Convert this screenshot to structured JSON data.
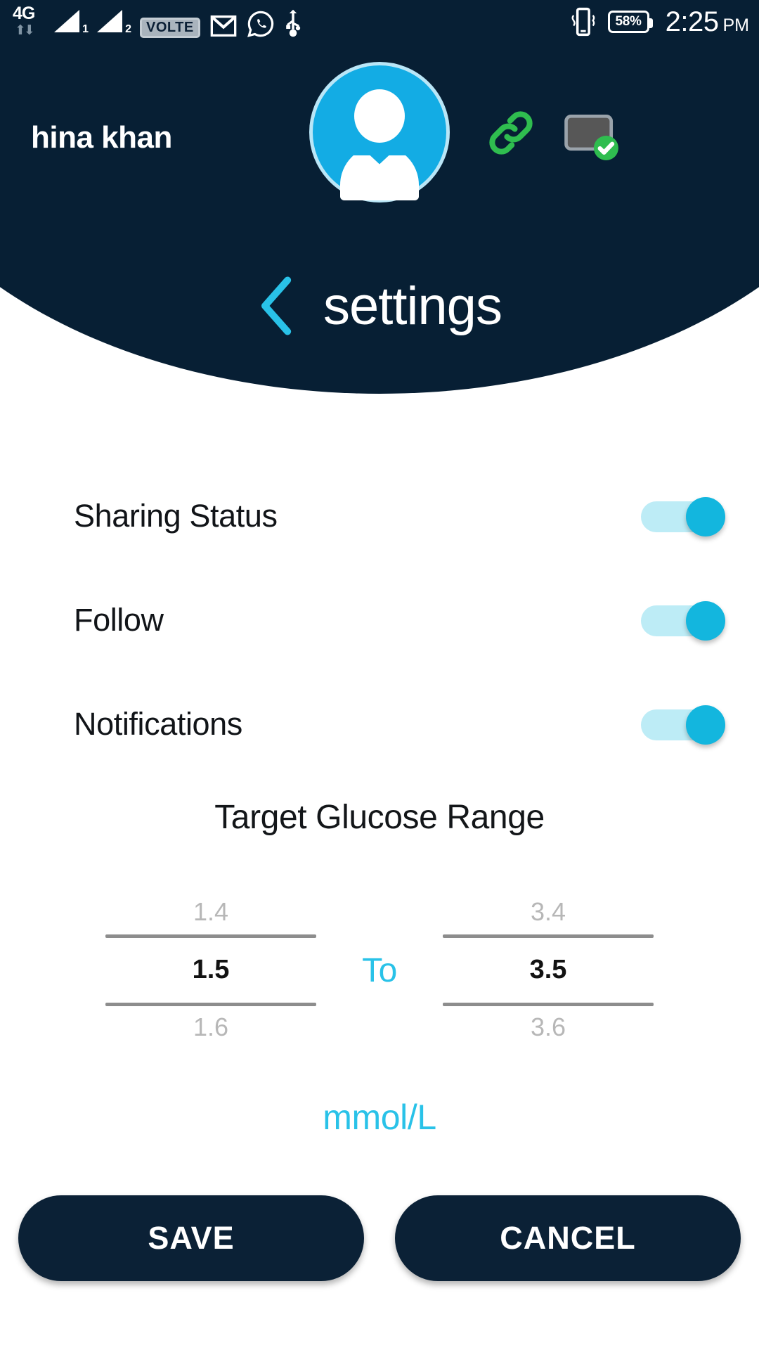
{
  "statusbar": {
    "network_label": "4G",
    "sim1_label": "1",
    "sim2_label": "2",
    "volte_label": "VOLTE",
    "battery_percent": "58%",
    "time": "2:25",
    "meridiem": "PM",
    "icons": [
      "4g-icon",
      "signal-sim1-icon",
      "signal-sim2-icon",
      "volte-badge",
      "gmail-icon",
      "whatsapp-icon",
      "usb-icon",
      "vibrate-icon",
      "battery-icon"
    ]
  },
  "header": {
    "user_name": "hina khan",
    "avatar_icon": "person-avatar-icon",
    "link_icon": "chain-link-icon",
    "cast_icon": "device-connected-icon",
    "background_color": "#071f34",
    "accent_color": "#29c2e8"
  },
  "page": {
    "title": "settings",
    "back_icon": "chevron-left-icon"
  },
  "settings": {
    "items": [
      {
        "label": "Sharing Status",
        "enabled": true
      },
      {
        "label": "Follow",
        "enabled": true
      },
      {
        "label": "Notifications",
        "enabled": true
      }
    ]
  },
  "glucose_range": {
    "title": "Target Glucose Range",
    "separator": "To",
    "unit": "mmol/L",
    "low": {
      "previous": "1.4",
      "selected": "1.5",
      "next": "1.6"
    },
    "high": {
      "previous": "3.4",
      "selected": "3.5",
      "next": "3.6"
    }
  },
  "actions": {
    "save_label": "SAVE",
    "cancel_label": "CANCEL"
  }
}
